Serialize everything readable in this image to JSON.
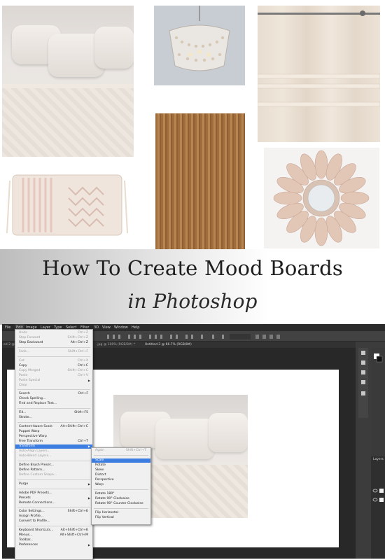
{
  "banner": {
    "title_line1": "How To Create Mood Boards",
    "title_line2": "in Photoshop"
  },
  "photoshop": {
    "menubar": [
      "File",
      "Edit",
      "Image",
      "Layer",
      "Type",
      "Select",
      "Filter",
      "3D",
      "View",
      "Window",
      "Help"
    ],
    "tabs": [
      "ed-2 @ 6",
      ".jpg @ 100% (RGB/8#) *",
      "Untitled-3 @ 66.7% (RGB/8#)"
    ],
    "layers_label": "Layers",
    "edit_menu": [
      {
        "label": "Undo",
        "shortcut": "Ctrl+Z",
        "disabled": true
      },
      {
        "label": "Step Forward",
        "shortcut": "Shift+Ctrl+Z",
        "disabled": true
      },
      {
        "label": "Step Backward",
        "shortcut": "Alt+Ctrl+Z",
        "disabled": false
      },
      {
        "label": "Fade...",
        "shortcut": "Shift+Ctrl+F",
        "disabled": true
      },
      {
        "label": "Cut",
        "shortcut": "Ctrl+X",
        "disabled": true
      },
      {
        "label": "Copy",
        "shortcut": "Ctrl+C",
        "disabled": false
      },
      {
        "label": "Copy Merged",
        "shortcut": "Shift+Ctrl+C",
        "disabled": true
      },
      {
        "label": "Paste",
        "shortcut": "Ctrl+V",
        "disabled": true
      },
      {
        "label": "Paste Special",
        "shortcut": "",
        "disabled": true
      },
      {
        "label": "Clear",
        "shortcut": "",
        "disabled": true
      },
      {
        "label": "Search",
        "shortcut": "Ctrl+F",
        "disabled": false
      },
      {
        "label": "Check Spelling...",
        "shortcut": "",
        "disabled": false
      },
      {
        "label": "Find and Replace Text...",
        "shortcut": "",
        "disabled": false
      },
      {
        "label": "Fill...",
        "shortcut": "Shift+F5",
        "disabled": false
      },
      {
        "label": "Stroke...",
        "shortcut": "",
        "disabled": false
      },
      {
        "label": "Content-Aware Scale",
        "shortcut": "Alt+Shift+Ctrl+C",
        "disabled": false
      },
      {
        "label": "Puppet Warp",
        "shortcut": "",
        "disabled": false
      },
      {
        "label": "Perspective Warp",
        "shortcut": "",
        "disabled": false
      },
      {
        "label": "Free Transform",
        "shortcut": "Ctrl+T",
        "disabled": false
      },
      {
        "label": "Transform",
        "shortcut": "",
        "disabled": false
      },
      {
        "label": "Auto-Align Layers...",
        "shortcut": "",
        "disabled": true
      },
      {
        "label": "Auto-Blend Layers...",
        "shortcut": "",
        "disabled": true
      },
      {
        "label": "Define Brush Preset...",
        "shortcut": "",
        "disabled": false
      },
      {
        "label": "Define Pattern...",
        "shortcut": "",
        "disabled": false
      },
      {
        "label": "Define Custom Shape...",
        "shortcut": "",
        "disabled": true
      },
      {
        "label": "Purge",
        "shortcut": "",
        "disabled": false
      },
      {
        "label": "Adobe PDF Presets...",
        "shortcut": "",
        "disabled": false
      },
      {
        "label": "Presets",
        "shortcut": "",
        "disabled": false
      },
      {
        "label": "Remote Connections...",
        "shortcut": "",
        "disabled": false
      },
      {
        "label": "Color Settings...",
        "shortcut": "Shift+Ctrl+K",
        "disabled": false
      },
      {
        "label": "Assign Profile...",
        "shortcut": "",
        "disabled": false
      },
      {
        "label": "Convert to Profile...",
        "shortcut": "",
        "disabled": false
      },
      {
        "label": "Keyboard Shortcuts...",
        "shortcut": "Alt+Shift+Ctrl+K",
        "disabled": false
      },
      {
        "label": "Menus...",
        "shortcut": "Alt+Shift+Ctrl+M",
        "disabled": false
      },
      {
        "label": "Toolbar...",
        "shortcut": "",
        "disabled": false
      },
      {
        "label": "Preferences",
        "shortcut": "",
        "disabled": false
      }
    ],
    "transform_submenu": [
      {
        "label": "Again",
        "shortcut": "Shift+Ctrl+T",
        "disabled": true
      },
      {
        "label": "Scale",
        "shortcut": "",
        "disabled": false
      },
      {
        "label": "Rotate",
        "shortcut": "",
        "disabled": false
      },
      {
        "label": "Skew",
        "shortcut": "",
        "disabled": false
      },
      {
        "label": "Distort",
        "shortcut": "",
        "disabled": false
      },
      {
        "label": "Perspective",
        "shortcut": "",
        "disabled": false
      },
      {
        "label": "Warp",
        "shortcut": "",
        "disabled": false
      },
      {
        "label": "Rotate 180°",
        "shortcut": "",
        "disabled": false
      },
      {
        "label": "Rotate 90° Clockwise",
        "shortcut": "",
        "disabled": false
      },
      {
        "label": "Rotate 90° Counter Clockwise",
        "shortcut": "",
        "disabled": false
      },
      {
        "label": "Flip Horizontal",
        "shortcut": "",
        "disabled": false
      },
      {
        "label": "Flip Vertical",
        "shortcut": "",
        "disabled": false
      }
    ],
    "highlighted_menu_item": "Transform",
    "highlighted_submenu_item": "Scale"
  },
  "colors": {
    "menu_highlight": "#3b7de0",
    "ps_background": "#282828"
  }
}
